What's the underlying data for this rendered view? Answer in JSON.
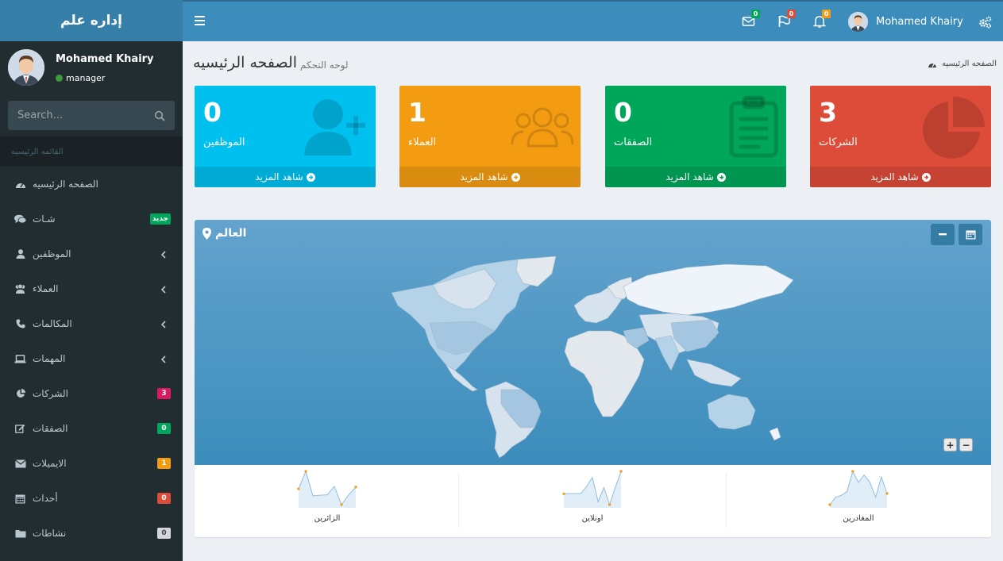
{
  "app": {
    "logo": "إداره علم"
  },
  "user": {
    "name": "Mohamed Khairy",
    "role": "manager"
  },
  "search": {
    "placeholder": "Search..."
  },
  "sidebar": {
    "header": "القائمه الرئيسيه",
    "items": [
      {
        "label": "الصفحه الرئيسيه",
        "icon": "dashboard-icon"
      },
      {
        "label": "شـات",
        "icon": "comments-icon",
        "badge": "جديد",
        "badge_color": "#00a65a"
      },
      {
        "label": "الموظفين",
        "icon": "user-icon",
        "chevron": true
      },
      {
        "label": "العملاء",
        "icon": "users-icon",
        "chevron": true
      },
      {
        "label": "المكالمات",
        "icon": "phone-icon",
        "chevron": true
      },
      {
        "label": "المهمات",
        "icon": "laptop-icon",
        "chevron": true
      },
      {
        "label": "الشركات",
        "icon": "pie-chart-icon",
        "badge": "3",
        "badge_color": "#d81b60"
      },
      {
        "label": "الصفقات",
        "icon": "edit-icon",
        "badge": "0",
        "badge_color": "#00a65a"
      },
      {
        "label": "الايميلات",
        "icon": "envelope-icon",
        "badge": "1",
        "badge_color": "#f39c12"
      },
      {
        "label": "أحداث",
        "icon": "calendar-icon",
        "badge": "0",
        "badge_color": "#dd4b39"
      },
      {
        "label": "نشاطات",
        "icon": "folder-icon",
        "badge": "0",
        "badge_color": "#d2d6de"
      }
    ]
  },
  "topbar": {
    "messages_count": "0",
    "flags_count": "0",
    "notifications_count": "0",
    "user_name": "Mohamed Khairy"
  },
  "content": {
    "title": "الصفحه الرئيسيه",
    "subtitle": "لوحه التحكم",
    "breadcrumb": "الصفحه الرئيسيه"
  },
  "boxes": [
    {
      "value": "0",
      "label": "الموظفين",
      "footer": "شاهد المزيد",
      "color": "#00c0ef",
      "icon": "user-plus-icon"
    },
    {
      "value": "1",
      "label": "العملاء",
      "footer": "شاهد المزيد",
      "color": "#f39c12",
      "icon": "users-icon"
    },
    {
      "value": "0",
      "label": "الصفقات",
      "footer": "شاهد المزيد",
      "color": "#00a65a",
      "icon": "clipboard-icon"
    },
    {
      "value": "3",
      "label": "الشركات",
      "footer": "شاهد المزيد",
      "color": "#dd4b39",
      "icon": "pie-chart-icon"
    }
  ],
  "map": {
    "title": "العالم",
    "zoom_in": "+",
    "zoom_out": "−"
  },
  "sparklines": [
    {
      "label": "الزائرين",
      "values": [
        1000,
        1200,
        920,
        927,
        931,
        1027,
        819,
        930,
        1021
      ]
    },
    {
      "label": "اونلاين",
      "values": [
        515,
        519,
        520,
        522,
        652,
        810,
        370,
        627,
        319,
        630,
        921
      ]
    },
    {
      "label": "المغادرين",
      "values": [
        15,
        19,
        20,
        22,
        33,
        27,
        31,
        27,
        19,
        30,
        21
      ]
    }
  ],
  "colors": {
    "sidebar_bg": "#222d32",
    "header_bg": "#3c8dbc",
    "accent_orange": "#f39c12"
  }
}
